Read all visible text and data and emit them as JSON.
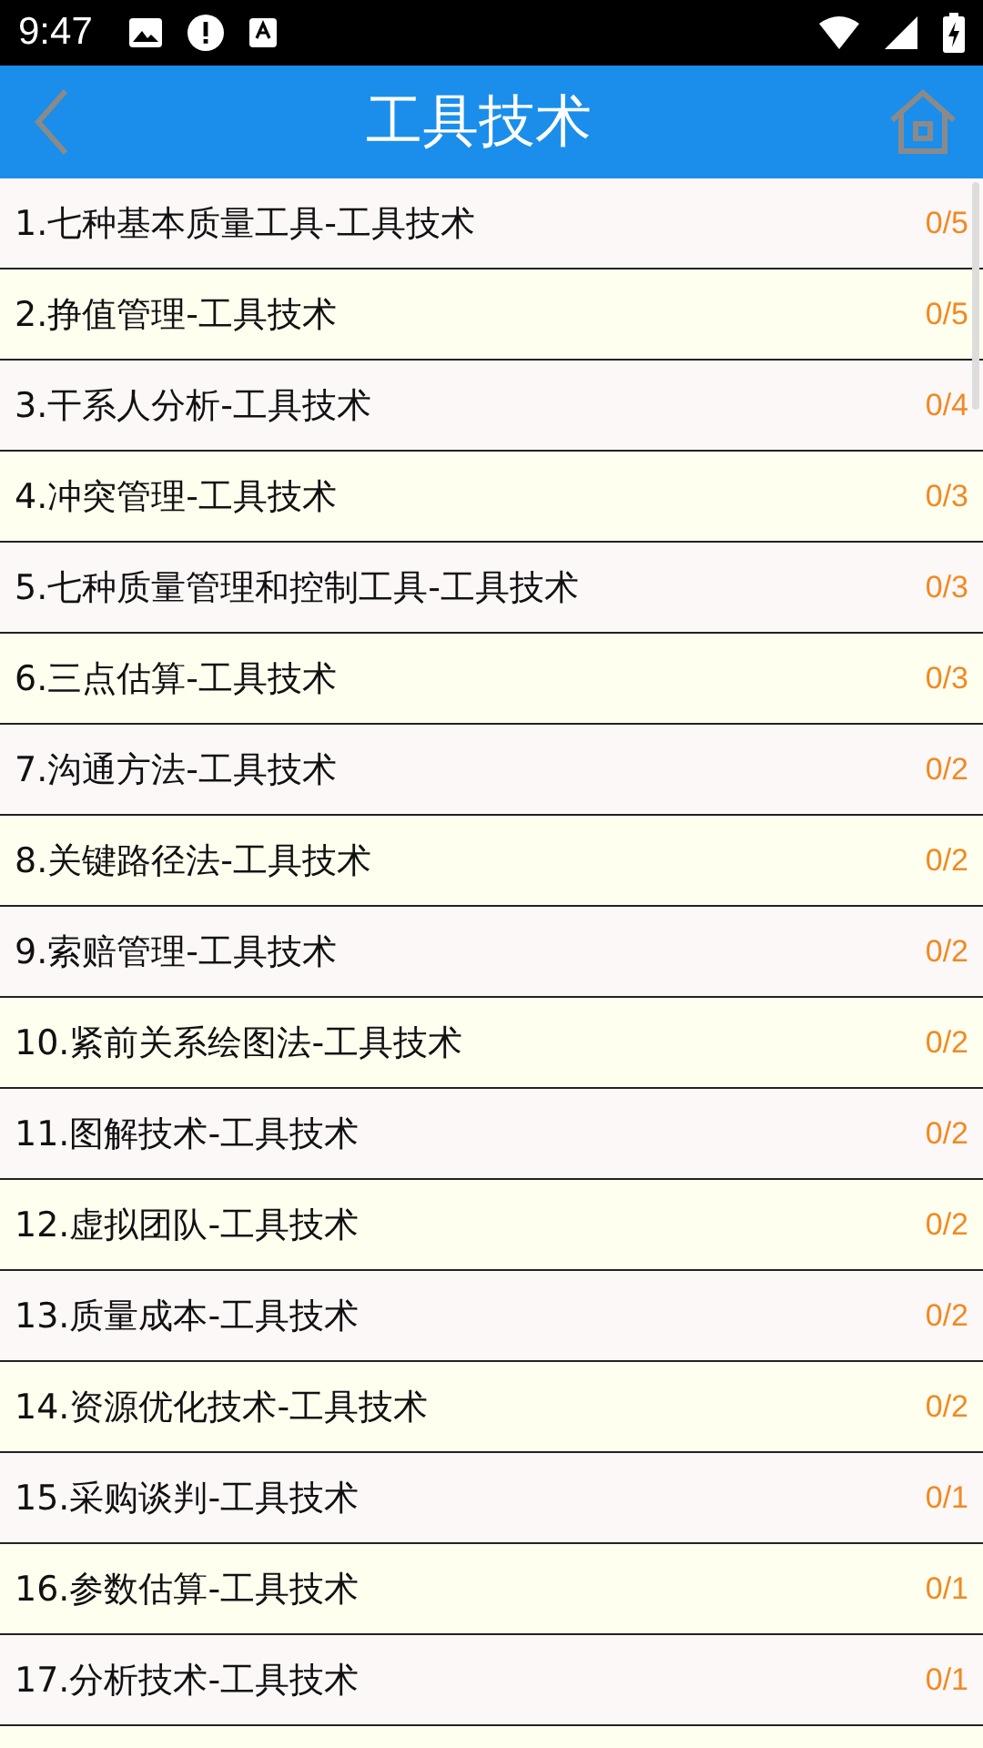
{
  "status_bar": {
    "time": "9:47"
  },
  "header": {
    "title": "工具技术"
  },
  "items": [
    {
      "label": "1.七种基本质量工具-工具技术",
      "count": "0/5"
    },
    {
      "label": "2.挣值管理-工具技术",
      "count": "0/5"
    },
    {
      "label": "3.干系人分析-工具技术",
      "count": "0/4"
    },
    {
      "label": "4.冲突管理-工具技术",
      "count": "0/3"
    },
    {
      "label": "5.七种质量管理和控制工具-工具技术",
      "count": "0/3"
    },
    {
      "label": "6.三点估算-工具技术",
      "count": "0/3"
    },
    {
      "label": "7.沟通方法-工具技术",
      "count": "0/2"
    },
    {
      "label": "8.关键路径法-工具技术",
      "count": "0/2"
    },
    {
      "label": "9.索赔管理-工具技术",
      "count": "0/2"
    },
    {
      "label": "10.紧前关系绘图法-工具技术",
      "count": "0/2"
    },
    {
      "label": "11.图解技术-工具技术",
      "count": "0/2"
    },
    {
      "label": "12.虚拟团队-工具技术",
      "count": "0/2"
    },
    {
      "label": "13.质量成本-工具技术",
      "count": "0/2"
    },
    {
      "label": "14.资源优化技术-工具技术",
      "count": "0/2"
    },
    {
      "label": "15.采购谈判-工具技术",
      "count": "0/1"
    },
    {
      "label": "16.参数估算-工具技术",
      "count": "0/1"
    },
    {
      "label": "17.分析技术-工具技术",
      "count": "0/1"
    }
  ]
}
